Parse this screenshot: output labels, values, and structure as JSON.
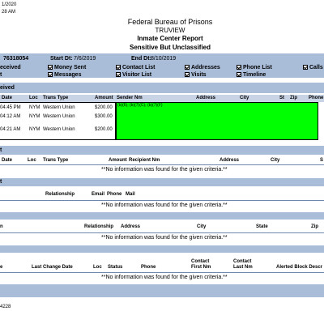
{
  "header": {
    "print_date": "1/2020",
    "print_time": "28 AM",
    "agency": "Federal Bureau of Prisons",
    "system": "TRUVIEW",
    "report_title": "Inmate Center Report",
    "classification": "Sensitive But Unclassified"
  },
  "criteria": {
    "register_label": "76318054",
    "start_label": "Start Dt:",
    "start_value": "7/6/2019",
    "end_label": "End Dt:",
    "end_value": "8/10/2019",
    "received_label": "eceived",
    "t_label": "t",
    "options": {
      "money_sent": "Money Sent",
      "messages": "Messages",
      "contact_list": "Contact List",
      "visitor_list": "Visitor List",
      "addresses": "Addresses",
      "visits": "Visits",
      "phone_list": "Phone List",
      "timeline": "Timeline",
      "calls": "Calls"
    }
  },
  "money_received": {
    "title": "eived",
    "headers": {
      "date": "Date",
      "loc": "Loc",
      "trans_type": "Trans Type",
      "amount": "Amount",
      "sender_nm": "Sender Nm",
      "address": "Address",
      "city": "City",
      "st": "St",
      "zip": "Zip",
      "phone": "Phone"
    },
    "rows": [
      {
        "date": "04:45 PM",
        "loc": "NYM",
        "trans_type": "Western Union",
        "amount": "$200.00"
      },
      {
        "date": "04:12 AM",
        "loc": "NYM",
        "trans_type": "Western Union",
        "amount": "$300.00"
      },
      {
        "date": "04:21 AM",
        "loc": "NYM",
        "trans_type": "Western Union",
        "amount": "$200.00"
      }
    ],
    "redaction_label": "(b)(6); (b)(7)(C); (b)(7)(F)"
  },
  "money_sent": {
    "title": "t",
    "headers": {
      "date": "Date",
      "loc": "Loc",
      "trans_type": "Trans Type",
      "amount": "Amount",
      "recipient_nm": "Recipient Nm",
      "address": "Address",
      "city": "City",
      "s": "S"
    },
    "no_data": "**No information was found for the given criteria.**"
  },
  "contact_list": {
    "title": "t",
    "headers": {
      "relationship": "Relationship",
      "email": "Email",
      "phone": "Phone",
      "mail": "Mail"
    },
    "no_data": "**No information was found for the given criteria.**"
  },
  "addresses": {
    "headers": {
      "n": "n",
      "relationship": "Relationship",
      "address": "Address",
      "city": "City",
      "state": "State",
      "zip": "Zip"
    },
    "no_data": "**No information was found for the given criteria.**"
  },
  "phone_list": {
    "headers": {
      "e": "e",
      "last_change_date": "Last Change Date",
      "loc": "Loc",
      "status": "Status",
      "phone": "Phone",
      "contact_first_1": "Contact",
      "contact_first_2": "First Nm",
      "contact_last_1": "Contact",
      "contact_last_2": "Last Nm",
      "alerted_block": "Alerted Block Descr"
    },
    "no_data": "**No information was found for the given criteria.**"
  },
  "footer": {
    "page_id": "4228"
  },
  "colors": {
    "band": "#a9bcd8",
    "redaction": "#00ff00"
  }
}
